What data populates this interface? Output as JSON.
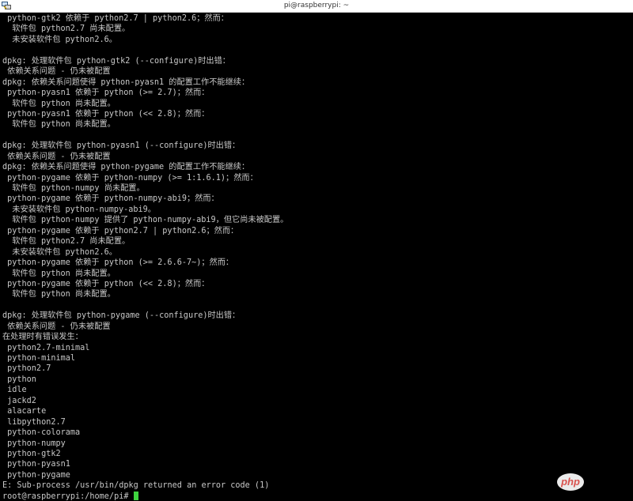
{
  "window": {
    "title": "pi@raspberrypi: ~"
  },
  "terminal": {
    "lines": [
      " python-gtk2 依赖于 python2.7 | python2.6；然而：",
      "  软件包 python2.7 尚未配置。",
      "  未安装软件包 python2.6。",
      "",
      "dpkg: 处理软件包 python-gtk2 (--configure)时出错：",
      " 依赖关系问题 - 仍未被配置",
      "dpkg: 依赖关系问题使得 python-pyasn1 的配置工作不能继续：",
      " python-pyasn1 依赖于 python (>= 2.7)；然而：",
      "  软件包 python 尚未配置。",
      " python-pyasn1 依赖于 python (<< 2.8)；然而：",
      "  软件包 python 尚未配置。",
      "",
      "dpkg: 处理软件包 python-pyasn1 (--configure)时出错：",
      " 依赖关系问题 - 仍未被配置",
      "dpkg: 依赖关系问题使得 python-pygame 的配置工作不能继续：",
      " python-pygame 依赖于 python-numpy (>= 1:1.6.1)；然而：",
      "  软件包 python-numpy 尚未配置。",
      " python-pygame 依赖于 python-numpy-abi9；然而：",
      "  未安装软件包 python-numpy-abi9。",
      "  软件包 python-numpy 提供了 python-numpy-abi9，但它尚未被配置。",
      " python-pygame 依赖于 python2.7 | python2.6；然而：",
      "  软件包 python2.7 尚未配置。",
      "  未安装软件包 python2.6。",
      " python-pygame 依赖于 python (>= 2.6.6-7~)；然而：",
      "  软件包 python 尚未配置。",
      " python-pygame 依赖于 python (<< 2.8)；然而：",
      "  软件包 python 尚未配置。",
      "",
      "dpkg: 处理软件包 python-pygame (--configure)时出错：",
      " 依赖关系问题 - 仍未被配置",
      "在处理时有错误发生：",
      " python2.7-minimal",
      " python-minimal",
      " python2.7",
      " python",
      " idle",
      " jackd2",
      " alacarte",
      " libpython2.7",
      " python-colorama",
      " python-numpy",
      " python-gtk2",
      " python-pyasn1",
      " python-pygame",
      "E: Sub-process /usr/bin/dpkg returned an error code (1)"
    ],
    "prompt": "root@raspberrypi:/home/pi# "
  },
  "watermark": {
    "text": "php"
  },
  "colors": {
    "terminal_bg": "#000000",
    "terminal_fg": "#c8c8c8",
    "cursor": "#3fd43f",
    "titlebar_bg": "#ffffff"
  }
}
